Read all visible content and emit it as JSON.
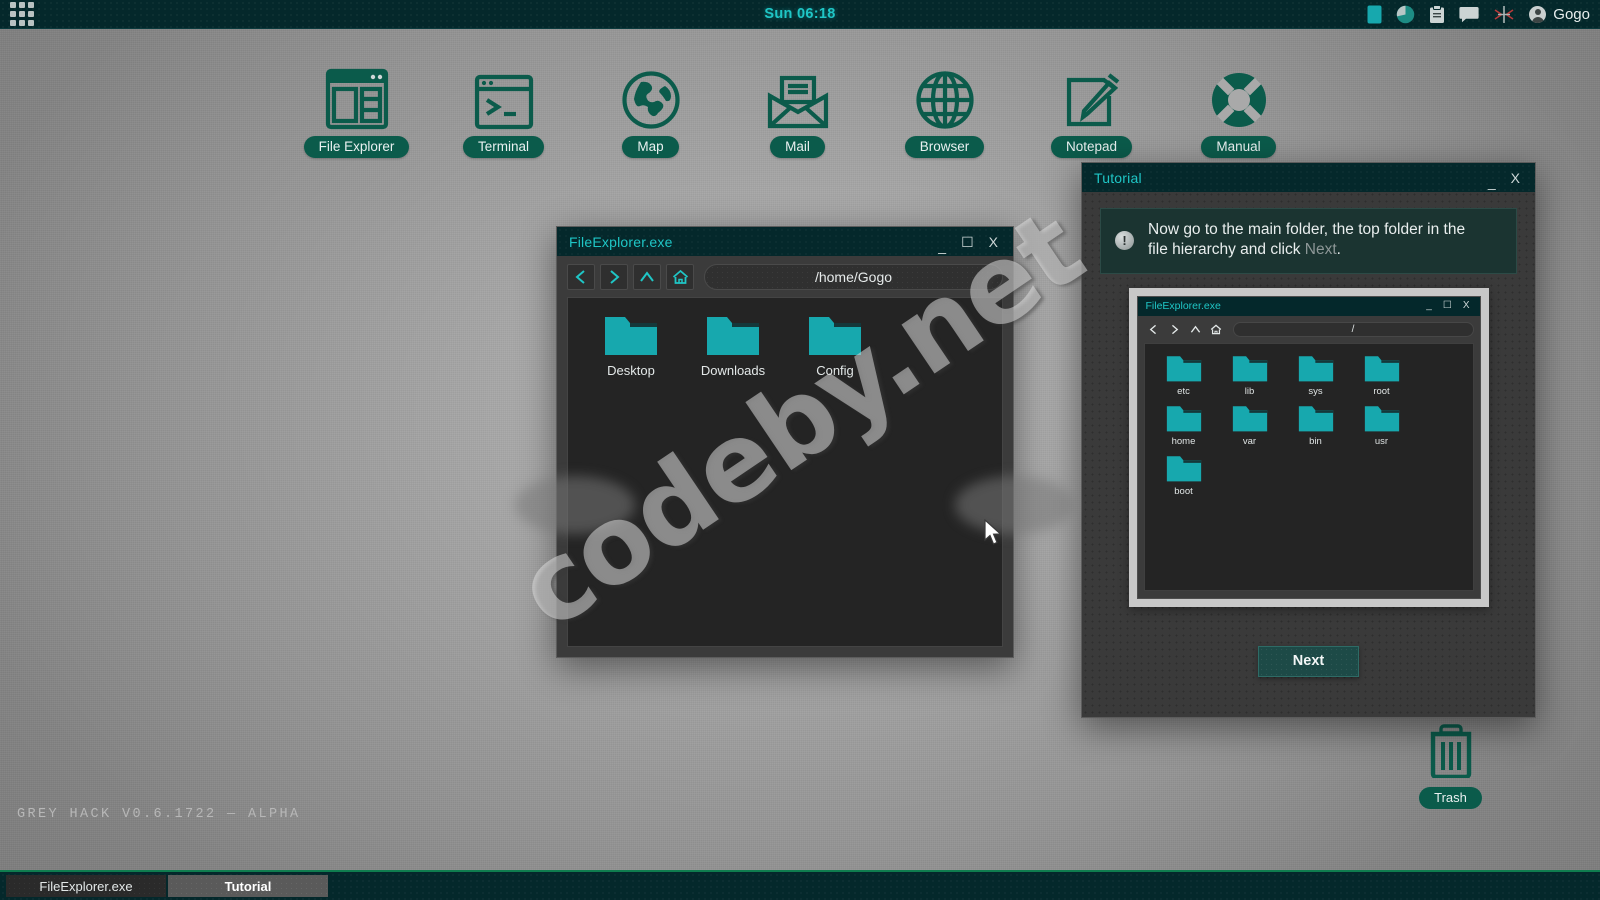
{
  "topbar": {
    "apps_button": "apps-grid",
    "clock": "Sun 06:18",
    "tray": [
      {
        "name": "battery-icon",
        "label": "battery"
      },
      {
        "name": "disk-usage-icon",
        "label": "disk usage"
      },
      {
        "name": "clipboard-icon",
        "label": "clipboard"
      },
      {
        "name": "chat-icon",
        "label": "chat"
      },
      {
        "name": "network-icon",
        "label": "network"
      }
    ],
    "user": "Gogo"
  },
  "desktop": {
    "icons": [
      {
        "label": "File Explorer",
        "icon": "file-explorer-icon"
      },
      {
        "label": "Terminal",
        "icon": "terminal-icon"
      },
      {
        "label": "Map",
        "icon": "map-icon"
      },
      {
        "label": "Mail",
        "icon": "mail-icon"
      },
      {
        "label": "Browser",
        "icon": "browser-icon"
      },
      {
        "label": "Notepad",
        "icon": "notepad-icon"
      },
      {
        "label": "Manual",
        "icon": "manual-icon"
      }
    ],
    "trash_label": "Trash",
    "version": "GREY HACK V0.6.1722 — ALPHA",
    "watermark": "codeby.net"
  },
  "file_explorer": {
    "title": "FileExplorer.exe",
    "window_buttons": {
      "minimize": "_",
      "maximize": "☐",
      "close": "X"
    },
    "nav": {
      "back": "back-button",
      "forward": "forward-button",
      "up": "up-button",
      "home": "home-button"
    },
    "path": "/home/Gogo",
    "files": [
      {
        "name": "Desktop",
        "type": "folder"
      },
      {
        "name": "Downloads",
        "type": "folder"
      },
      {
        "name": "Config",
        "type": "folder"
      }
    ]
  },
  "tutorial": {
    "title": "Tutorial",
    "window_buttons": {
      "minimize": "_",
      "close": "X"
    },
    "message_line1": "Now go to the main folder, the top folder in the",
    "message_line2_pre": "file hierarchy and click ",
    "message_highlight": "Next",
    "message_line2_post": ".",
    "next_label": "Next",
    "screenshot": {
      "title": "FileExplorer.exe",
      "window_buttons": {
        "minimize": "_",
        "maximize": "☐",
        "close": "X"
      },
      "path": "/",
      "files": [
        {
          "name": "etc",
          "type": "folder"
        },
        {
          "name": "lib",
          "type": "folder"
        },
        {
          "name": "sys",
          "type": "folder"
        },
        {
          "name": "root",
          "type": "folder"
        },
        {
          "name": "home",
          "type": "folder"
        },
        {
          "name": "var",
          "type": "folder"
        },
        {
          "name": "bin",
          "type": "folder"
        },
        {
          "name": "usr",
          "type": "folder"
        },
        {
          "name": "boot",
          "type": "folder"
        }
      ]
    }
  },
  "taskbar": {
    "items": [
      {
        "label": "FileExplorer.exe",
        "active": false
      },
      {
        "label": "Tutorial",
        "active": true
      }
    ]
  },
  "colors": {
    "accent_teal": "#1fc6c6",
    "folder_teal": "#17a8ae",
    "icon_green": "#0b5b4b",
    "topbar_dark": "#04282b",
    "taskbar_border": "#0f7d4f"
  }
}
